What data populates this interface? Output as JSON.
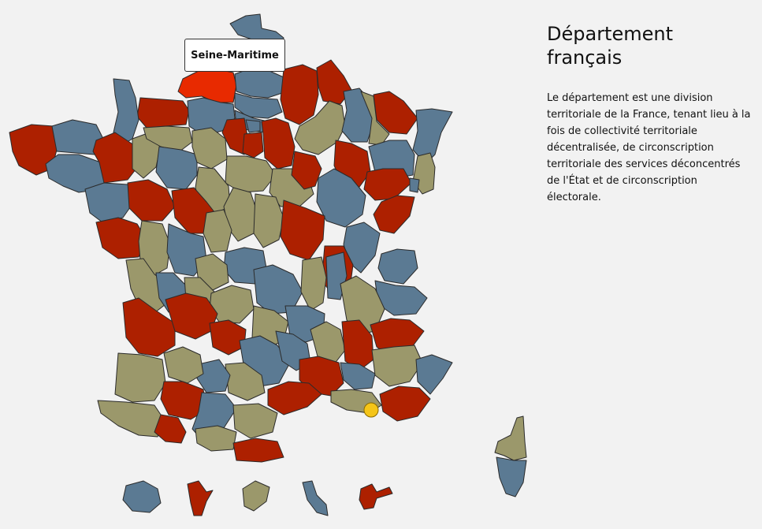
{
  "info": {
    "title": "Département français",
    "description": "Le département est une division territoriale de la France, tenant lieu à la fois de collectivité territoriale décentralisée, de circonscription territoriale des services déconcentrés de l'État et de circonscription électorale."
  },
  "tooltip": {
    "label": "Seine-Maritime"
  },
  "colors": {
    "background": "#f2f2f2",
    "red": "#ad2000",
    "blue": "#5b7a93",
    "olive": "#9b986b",
    "highlight": "#e82a00",
    "marker": "#f5c518",
    "border": "#2b2b2b"
  },
  "map": {
    "highlighted_department": "Seine-Maritime",
    "marker": "yellow-circle"
  }
}
